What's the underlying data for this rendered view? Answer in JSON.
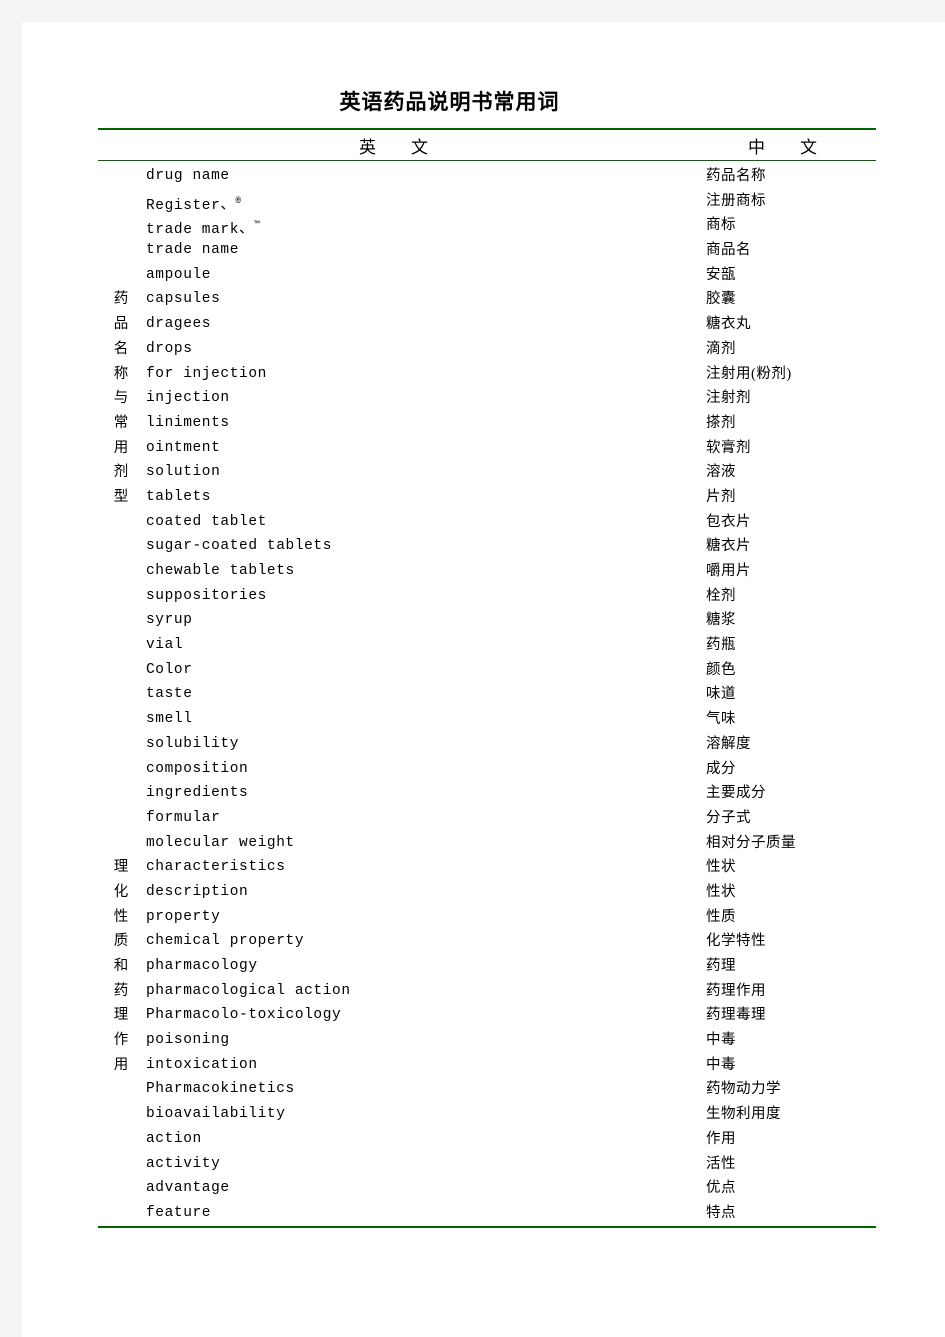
{
  "document": {
    "title": "英语药品说明书常用词"
  },
  "table": {
    "headers": {
      "english": "英　文",
      "chinese": "中　文"
    },
    "rows": [
      {
        "mark": "",
        "en": "drug name",
        "sup": "",
        "zh": "药品名称"
      },
      {
        "mark": "",
        "en": "Register、",
        "sup": "®",
        "zh": "注册商标"
      },
      {
        "mark": "",
        "en": "trade mark、",
        "sup": "™",
        "zh": "商标"
      },
      {
        "mark": "",
        "en": "trade name",
        "sup": "",
        "zh": "商品名"
      },
      {
        "mark": "",
        "en": "ampoule",
        "sup": "",
        "zh": "安瓿"
      },
      {
        "mark": "药",
        "en": "capsules",
        "sup": "",
        "zh": "胶囊"
      },
      {
        "mark": "品",
        "en": "dragees",
        "sup": "",
        "zh": "糖衣丸"
      },
      {
        "mark": "名",
        "en": "drops",
        "sup": "",
        "zh": "滴剂"
      },
      {
        "mark": "称",
        "en": "for injection",
        "sup": "",
        "zh": "注射用(粉剂)"
      },
      {
        "mark": "与",
        "en": "injection",
        "sup": "",
        "zh": "注射剂"
      },
      {
        "mark": "常",
        "en": "liniments",
        "sup": "",
        "zh": "搽剂"
      },
      {
        "mark": "用",
        "en": "ointment",
        "sup": "",
        "zh": "软膏剂"
      },
      {
        "mark": "剂",
        "en": "solution",
        "sup": "",
        "zh": "溶液"
      },
      {
        "mark": "型",
        "en": "tablets",
        "sup": "",
        "zh": "片剂"
      },
      {
        "mark": "",
        "en": "coated tablet",
        "sup": "",
        "zh": "包衣片"
      },
      {
        "mark": "",
        "en": "sugar-coated tablets",
        "sup": "",
        "zh": "糖衣片"
      },
      {
        "mark": "",
        "en": "chewable tablets",
        "sup": "",
        "zh": "嚼用片"
      },
      {
        "mark": "",
        "en": "suppositories",
        "sup": "",
        "zh": "栓剂"
      },
      {
        "mark": "",
        "en": "syrup",
        "sup": "",
        "zh": "糖浆"
      },
      {
        "mark": "",
        "en": "vial",
        "sup": "",
        "zh": "药瓶"
      },
      {
        "mark": "",
        "en": "Color",
        "sup": "",
        "zh": "颜色"
      },
      {
        "mark": "",
        "en": "taste",
        "sup": "",
        "zh": "味道"
      },
      {
        "mark": "",
        "en": "smell",
        "sup": "",
        "zh": "气味"
      },
      {
        "mark": "",
        "en": "solubility",
        "sup": "",
        "zh": "溶解度"
      },
      {
        "mark": "",
        "en": "composition",
        "sup": "",
        "zh": "成分"
      },
      {
        "mark": "",
        "en": "ingredients",
        "sup": "",
        "zh": "主要成分"
      },
      {
        "mark": "",
        "en": "formular",
        "sup": "",
        "zh": "分子式"
      },
      {
        "mark": "",
        "en": "molecular weight",
        "sup": "",
        "zh": "相对分子质量"
      },
      {
        "mark": "理",
        "en": "characteristics",
        "sup": "",
        "zh": "性状"
      },
      {
        "mark": "化",
        "en": "description",
        "sup": "",
        "zh": "性状"
      },
      {
        "mark": "性",
        "en": "property",
        "sup": "",
        "zh": "性质"
      },
      {
        "mark": "质",
        "en": "chemical property",
        "sup": "",
        "zh": "化学特性"
      },
      {
        "mark": "和",
        "en": "pharmacology",
        "sup": "",
        "zh": "药理"
      },
      {
        "mark": "药",
        "en": "pharmacological action",
        "sup": "",
        "zh": "药理作用"
      },
      {
        "mark": "理",
        "en": "Pharmacolo-toxicology",
        "sup": "",
        "zh": "药理毒理"
      },
      {
        "mark": "作",
        "en": "poisoning",
        "sup": "",
        "zh": "中毒"
      },
      {
        "mark": "用",
        "en": "intoxication",
        "sup": "",
        "zh": "中毒"
      },
      {
        "mark": "",
        "en": "Pharmacokinetics",
        "sup": "",
        "zh": "药物动力学"
      },
      {
        "mark": "",
        "en": "bioavailability",
        "sup": "",
        "zh": "生物利用度"
      },
      {
        "mark": "",
        "en": "action",
        "sup": "",
        "zh": "作用"
      },
      {
        "mark": "",
        "en": "activity",
        "sup": "",
        "zh": "活性"
      },
      {
        "mark": "",
        "en": "advantage",
        "sup": "",
        "zh": "优点"
      },
      {
        "mark": "",
        "en": "feature",
        "sup": "",
        "zh": "特点"
      }
    ]
  },
  "style": {
    "rule_color": "#006600",
    "page_background": "#ffffff",
    "canvas_background": "#f4f4f4"
  }
}
